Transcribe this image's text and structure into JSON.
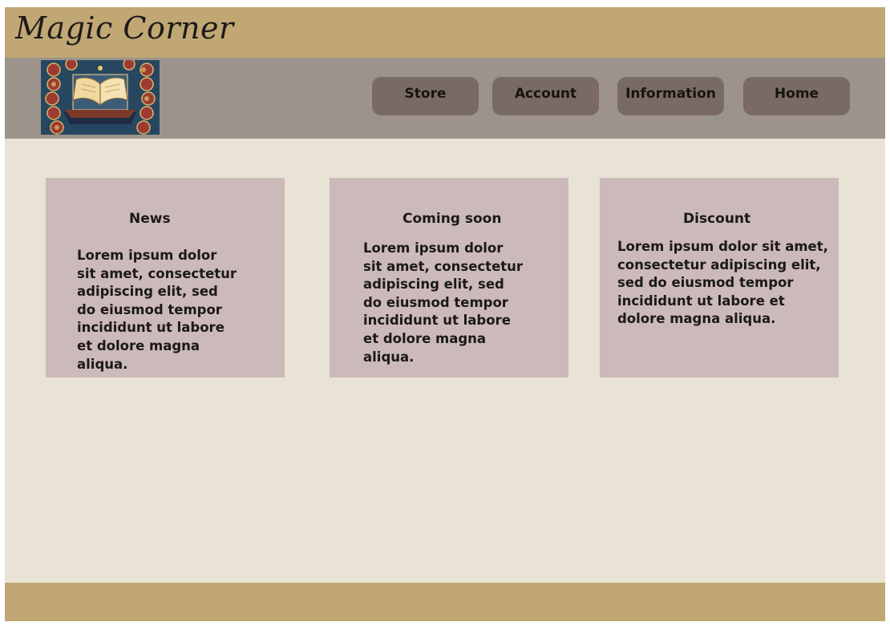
{
  "header": {
    "brand": "Magic Corner"
  },
  "nav": {
    "logo_alt": "Open book with magic symbols",
    "items": [
      {
        "label": "Store"
      },
      {
        "label": "Account"
      },
      {
        "label": "Information"
      },
      {
        "label": "Home"
      }
    ]
  },
  "cards": [
    {
      "title": "News",
      "text": "Lorem ipsum dolor sit amet, consectetur adipiscing elit, sed do eiusmod tempor incididunt ut labore et dolore magna aliqua."
    },
    {
      "title": "Coming soon",
      "text": "Lorem ipsum dolor sit amet, consectetur adipiscing elit, sed do eiusmod tempor incididunt ut labore et dolore magna aliqua."
    },
    {
      "title": "Discount",
      "text": "Lorem ipsum dolor sit amet, consectetur adipiscing elit, sed do eiusmod tempor incididunt ut labore et dolore magna aliqua."
    }
  ],
  "colors": {
    "header_bg": "#c0a774",
    "nav_bg": "#9c948a",
    "nav_button_bg": "#7a6a64",
    "page_bg": "#e8e3d5",
    "card_bg": "#ccb9b9",
    "footer_bg": "#c0a774"
  }
}
